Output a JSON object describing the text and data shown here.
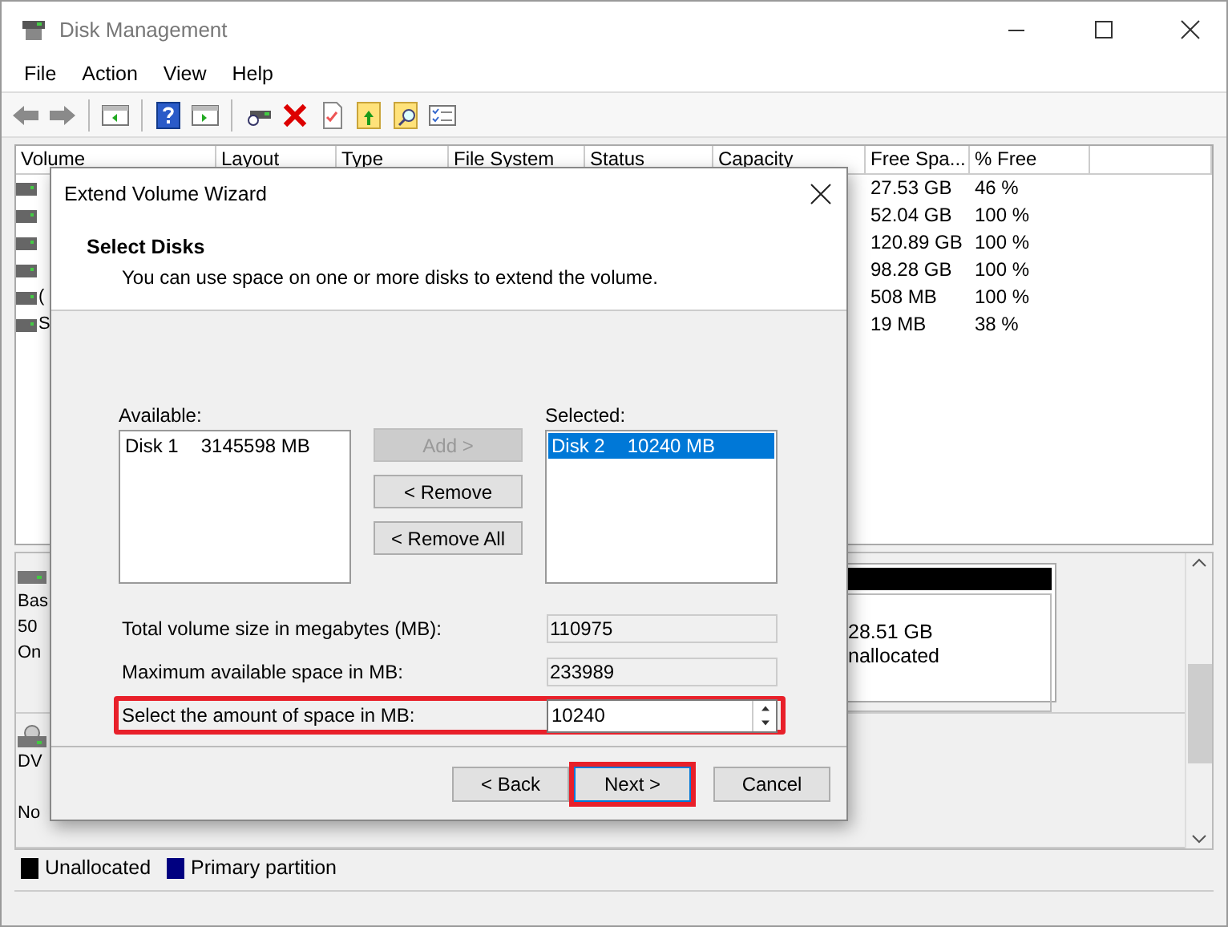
{
  "window": {
    "title": "Disk Management"
  },
  "menu": [
    "File",
    "Action",
    "View",
    "Help"
  ],
  "volume_table": {
    "columns": [
      "Volume",
      "Layout",
      "Type",
      "File System",
      "Status",
      "Capacity",
      "Free Spa...",
      "% Free"
    ],
    "rows": [
      {
        "free_space": "27.53 GB",
        "percent_free": "46 %"
      },
      {
        "free_space": "52.04 GB",
        "percent_free": "100 %"
      },
      {
        "free_space": "120.89 GB",
        "percent_free": "100 %"
      },
      {
        "free_space": "98.28 GB",
        "percent_free": "100 %"
      },
      {
        "volume": "(",
        "free_space": "508 MB",
        "percent_free": "100 %"
      },
      {
        "volume": "S",
        "free_space": "19 MB",
        "percent_free": "38 %"
      }
    ]
  },
  "disks": [
    {
      "kind": "hdd",
      "lines": [
        "Bas",
        "50",
        "On"
      ],
      "partition": {
        "size": "28.51 GB",
        "status": "nallocated"
      }
    },
    {
      "kind": "dvd",
      "lines": [
        "DV",
        "No"
      ]
    }
  ],
  "legend": [
    {
      "label": "Unallocated",
      "color": "#000000"
    },
    {
      "label": "Primary partition",
      "color": "#000080"
    }
  ],
  "dialog": {
    "title": "Extend Volume Wizard",
    "heading": "Select Disks",
    "subtitle": "You can use space on one or more disks to extend the volume.",
    "available": {
      "label": "Available:",
      "items": [
        {
          "name": "Disk 1",
          "size": "3145598 MB",
          "selected": false
        }
      ]
    },
    "move_buttons": [
      {
        "label": "Add >",
        "disabled": true
      },
      {
        "label": "< Remove",
        "disabled": false
      },
      {
        "label": "< Remove All",
        "disabled": false
      }
    ],
    "selected_list": {
      "label": "Selected:",
      "items": [
        {
          "name": "Disk 2",
          "size": "10240 MB",
          "selected": true
        }
      ]
    },
    "fields": [
      {
        "label": "Total volume size in megabytes (MB):",
        "value": "110975",
        "kind": "readonly",
        "highlighted": false
      },
      {
        "label": "Maximum available space in MB:",
        "value": "233989",
        "kind": "readonly",
        "highlighted": false
      },
      {
        "label": "Select the amount of space in MB:",
        "value": "10240",
        "kind": "spin",
        "highlighted": true
      }
    ],
    "buttons": [
      {
        "label": "< Back",
        "highlighted": false
      },
      {
        "label": "Next >",
        "highlighted": true
      },
      {
        "label": "Cancel",
        "highlighted": false
      }
    ]
  }
}
